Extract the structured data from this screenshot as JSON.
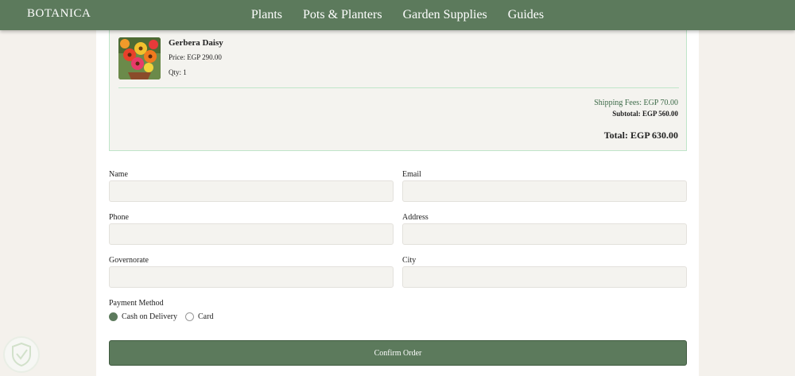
{
  "header": {
    "logo": "BOTANICA",
    "nav": [
      "Plants",
      "Pots & Planters",
      "Garden Supplies",
      "Guides"
    ]
  },
  "cart": {
    "item": {
      "name": "Gerbera Daisy",
      "price": "Price: EGP 290.00",
      "qty": "Qty: 1"
    },
    "shipping": "Shipping Fees: EGP 70.00",
    "subtotal": "Subtotal: EGP 560.00",
    "total": "Total: EGP 630.00"
  },
  "form": {
    "name_label": "Name",
    "email_label": "Email",
    "phone_label": "Phone",
    "address_label": "Address",
    "governorate_label": "Governorate",
    "city_label": "City",
    "payment_label": "Payment Method",
    "payment_options": [
      "Cash on Delivery",
      "Card"
    ],
    "selected_payment": "Cash on Delivery",
    "confirm_label": "Confirm Order"
  },
  "colors": {
    "accent": "#5c7a5c",
    "border_green": "#bfe5c9",
    "background": "#f4f1ec"
  }
}
